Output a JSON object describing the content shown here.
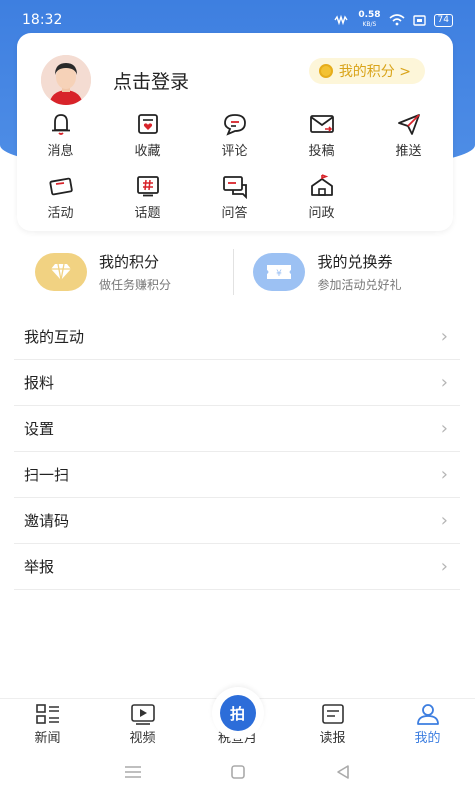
{
  "status_bar": {
    "time": "18:32",
    "speed_value": "0.58",
    "speed_unit": "KB/S",
    "battery": "74"
  },
  "profile": {
    "login_label": "点击登录",
    "points_pill": "我的积分 >"
  },
  "grid": {
    "row1": [
      {
        "label": "消息",
        "icon": "bell-icon"
      },
      {
        "label": "收藏",
        "icon": "favorite-icon"
      },
      {
        "label": "评论",
        "icon": "comment-icon"
      },
      {
        "label": "投稿",
        "icon": "mail-icon"
      },
      {
        "label": "推送",
        "icon": "send-icon"
      }
    ],
    "row2": [
      {
        "label": "活动",
        "icon": "ticket-icon"
      },
      {
        "label": "话题",
        "icon": "hashtag-icon"
      },
      {
        "label": "问答",
        "icon": "qa-icon"
      },
      {
        "label": "问政",
        "icon": "government-icon"
      }
    ]
  },
  "strip": {
    "points": {
      "title": "我的积分",
      "subtitle": "做任务赚积分",
      "icon": "diamond-icon"
    },
    "vouchers": {
      "title": "我的兑换券",
      "subtitle": "参加活动兑好礼",
      "icon": "voucher-icon"
    }
  },
  "menu": [
    "我的互动",
    "报料",
    "设置",
    "扫一扫",
    "邀请码",
    "举报"
  ],
  "bottom_nav": {
    "news": "新闻",
    "video": "视频",
    "center_button": "拍",
    "center_label": "税宣月",
    "newspaper": "读报",
    "mine": "我的",
    "active": "mine"
  },
  "colors": {
    "primary": "#3d7ee0",
    "gold": "#d9a41a"
  }
}
